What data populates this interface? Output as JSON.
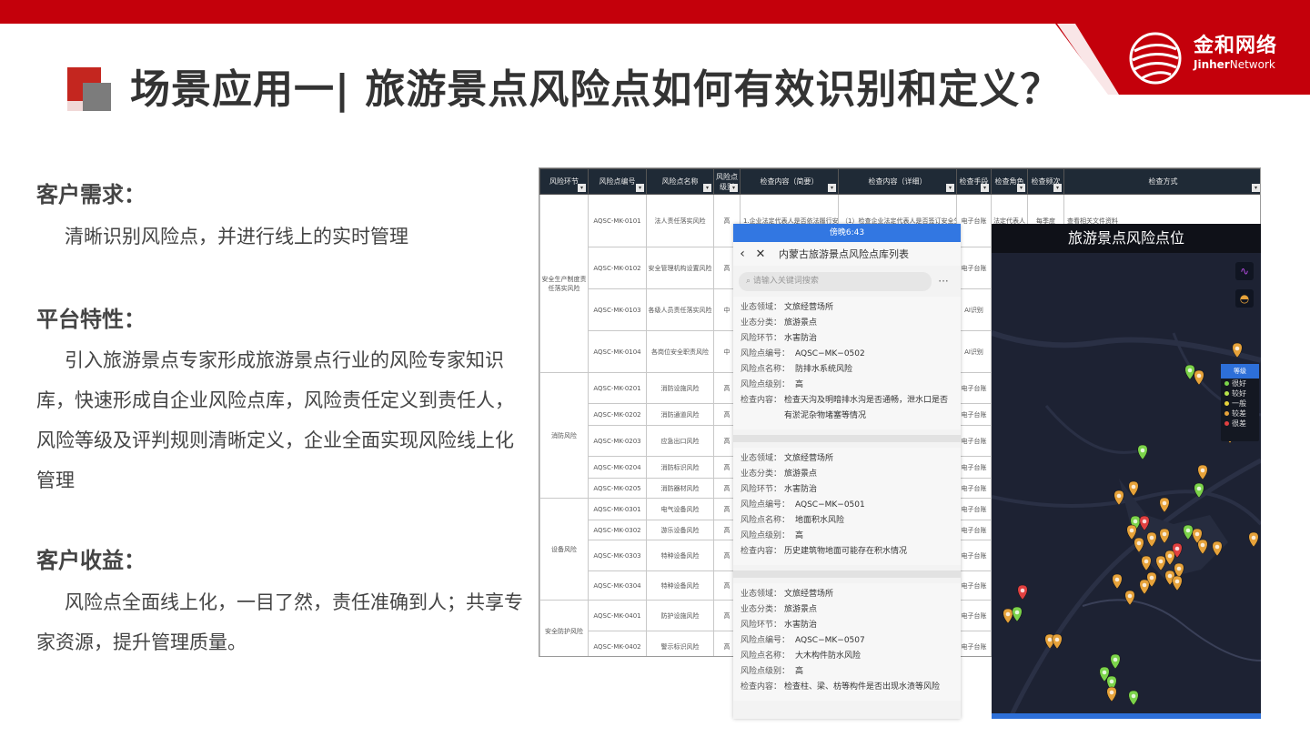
{
  "slide": {
    "title": "场景应用一| 旅游景点风险点如何有效识别和定义？",
    "logo": {
      "cn": "金和网络",
      "en_bold": "Jinher",
      "en_light": "Network"
    }
  },
  "sections": [
    {
      "heading": "客户需求：",
      "body": "清晰识别风险点，并进行线上的实时管理"
    },
    {
      "heading": "平台特性：",
      "body": "引入旅游景点专家形成旅游景点行业的风险专家知识库，快速形成自企业风险点库，风险责任定义到责任人，风险等级及评判规则清晰定义，企业全面实现风险线上化管理"
    },
    {
      "heading": "客户收益：",
      "body": "风险点全面线上化，一目了然，责任准确到人；共享专家资源，提升管理质量。"
    }
  ],
  "sheet": {
    "headers": [
      "风险环节",
      "风险点编号",
      "风险点名称",
      "风险点级别",
      "检查内容（简要）",
      "检查内容（详细）",
      "检查手段",
      "检查角色",
      "检查频次",
      "检查方式"
    ],
    "groups": [
      {
        "name": "安全生产制度责任落实风险",
        "rows": [
          {
            "code": "AQSC-MK-0101",
            "name": "法人责任落实风险",
            "level": "高",
            "brief": "1.企业法定代表人是否依法履行安全生产职责",
            "detail": "（1）检查企业法定代表人是否签订安全生产责任书",
            "means": "电子台账",
            "role": "法定代表人",
            "freq": "每季度",
            "method": "查看相关文件资料"
          },
          {
            "code": "AQSC-MK-0102",
            "name": "安全管理机构设置风险",
            "level": "高",
            "brief": "",
            "detail": "",
            "means": "电子台账",
            "role": "",
            "freq": "",
            "method": ""
          },
          {
            "code": "AQSC-MK-0103",
            "name": "各级人员责任落实风险",
            "level": "中",
            "brief": "",
            "detail": "",
            "means": "AI识别",
            "role": "",
            "freq": "",
            "method": ""
          },
          {
            "code": "AQSC-MK-0104",
            "name": "各岗位安全职责风险",
            "level": "中",
            "brief": "",
            "detail": "",
            "means": "AI识别",
            "role": "",
            "freq": "",
            "method": ""
          }
        ]
      },
      {
        "name": "消防风险",
        "rows": [
          {
            "code": "AQSC-MK-0201",
            "name": "消防设施风险",
            "level": "高",
            "brief": "",
            "detail": "",
            "means": "电子台账",
            "role": "",
            "freq": "",
            "method": ""
          },
          {
            "code": "AQSC-MK-0202",
            "name": "消防通道风险",
            "level": "高",
            "brief": "",
            "detail": "",
            "means": "电子台账",
            "role": "",
            "freq": "",
            "method": ""
          },
          {
            "code": "AQSC-MK-0203",
            "name": "应急出口风险",
            "level": "高",
            "brief": "",
            "detail": "",
            "means": "电子台账",
            "role": "",
            "freq": "",
            "method": ""
          },
          {
            "code": "AQSC-MK-0204",
            "name": "消防标识风险",
            "level": "高",
            "brief": "",
            "detail": "",
            "means": "电子台账",
            "role": "",
            "freq": "",
            "method": ""
          },
          {
            "code": "AQSC-MK-0205",
            "name": "消防器材风险",
            "level": "高",
            "brief": "",
            "detail": "",
            "means": "电子台账",
            "role": "",
            "freq": "",
            "method": ""
          }
        ]
      },
      {
        "name": "设备风险",
        "rows": [
          {
            "code": "AQSC-MK-0301",
            "name": "电气设备风险",
            "level": "高",
            "brief": "",
            "detail": "",
            "means": "电子台账",
            "role": "",
            "freq": "",
            "method": ""
          },
          {
            "code": "AQSC-MK-0302",
            "name": "游乐设备风险",
            "level": "高",
            "brief": "",
            "detail": "",
            "means": "电子台账",
            "role": "",
            "freq": "",
            "method": ""
          },
          {
            "code": "AQSC-MK-0303",
            "name": "特种设备风险",
            "level": "高",
            "brief": "",
            "detail": "",
            "means": "电子台账",
            "role": "",
            "freq": "",
            "method": ""
          },
          {
            "code": "AQSC-MK-0304",
            "name": "特种设备风险",
            "level": "高",
            "brief": "",
            "detail": "",
            "means": "电子台账",
            "role": "",
            "freq": "",
            "method": ""
          }
        ]
      },
      {
        "name": "安全防护风险",
        "rows": [
          {
            "code": "AQSC-MK-0401",
            "name": "防护设施风险",
            "level": "高",
            "brief": "",
            "detail": "",
            "means": "电子台账",
            "role": "",
            "freq": "",
            "method": ""
          },
          {
            "code": "AQSC-MK-0402",
            "name": "警示标识风险",
            "level": "高",
            "brief": "",
            "detail": "",
            "means": "电子台账",
            "role": "",
            "freq": "",
            "method": ""
          }
        ]
      }
    ]
  },
  "phone": {
    "status_time": "傍晚6:43",
    "nav_title": "内蒙古旅游景点风险点库列表",
    "search_placeholder": "请输入关键词搜索",
    "field_labels": {
      "domain": "业态领域：",
      "category": "业态分类：",
      "link": "风险环节：",
      "code": "风险点编号：",
      "name": "风险点名称：",
      "level": "风险点级别：",
      "content": "检查内容："
    },
    "cards": [
      {
        "domain": "文旅经营场所",
        "category": "旅游景点",
        "link": "水害防治",
        "code": "AQSC−MK−0502",
        "name": "防排水系统风险",
        "level": "高",
        "content": "检查天沟及明暗排水沟是否通畅，泄水口是否有淤泥杂物堵塞等情况"
      },
      {
        "domain": "文旅经营场所",
        "category": "旅游景点",
        "link": "水害防治",
        "code": "AQSC−MK−0501",
        "name": "地面积水风险",
        "level": "高",
        "content": "历史建筑物地面可能存在积水情况"
      },
      {
        "domain": "文旅经营场所",
        "category": "旅游景点",
        "link": "水害防治",
        "code": "AQSC−MK−0507",
        "name": "大木构件防水风险",
        "level": "高",
        "content": "检查柱、梁、枋等构件是否出现水渍等风险"
      }
    ]
  },
  "map": {
    "title": "旅游景点风险点位",
    "legend_title": "等级",
    "legend": [
      {
        "label": "很好",
        "color": "#7bd34a"
      },
      {
        "label": "较好",
        "color": "#b7e34a"
      },
      {
        "label": "一般",
        "color": "#e6d23a"
      },
      {
        "label": "较差",
        "color": "#e6a23a"
      },
      {
        "label": "很差",
        "color": "#e04040"
      }
    ],
    "tool_icons": [
      "chart-line-icon",
      "layers-icon"
    ]
  },
  "colors": {
    "brand_red": "#c4000b",
    "accent_grey": "#7c7c7c",
    "phone_blue": "#3277e2",
    "map_bg": "#1d2233"
  }
}
